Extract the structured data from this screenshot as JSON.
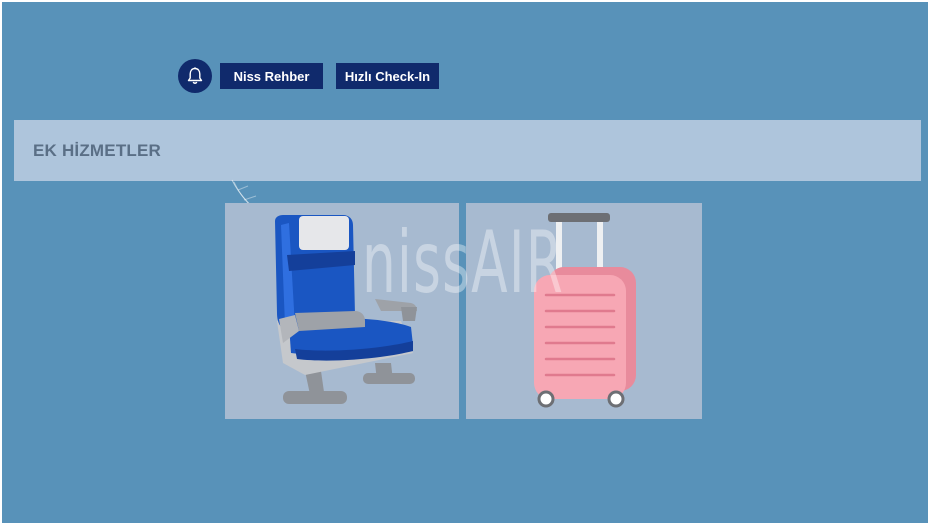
{
  "toolbar": {
    "bell_icon": "bell-icon",
    "guide_label": "Niss Rehber",
    "checkin_label": "Hızlı Check-In"
  },
  "section": {
    "title": "EK HİZMETLER"
  },
  "services": [
    {
      "icon": "seat-icon"
    },
    {
      "icon": "luggage-icon"
    }
  ],
  "watermark": "nissAIR",
  "colors": {
    "background": "#5892b9",
    "button": "#102a6c",
    "header_band": "#aec5dc",
    "card": "#a7bad0",
    "seat_blue": "#1a56c2",
    "luggage_pink": "#f7a7b4"
  }
}
